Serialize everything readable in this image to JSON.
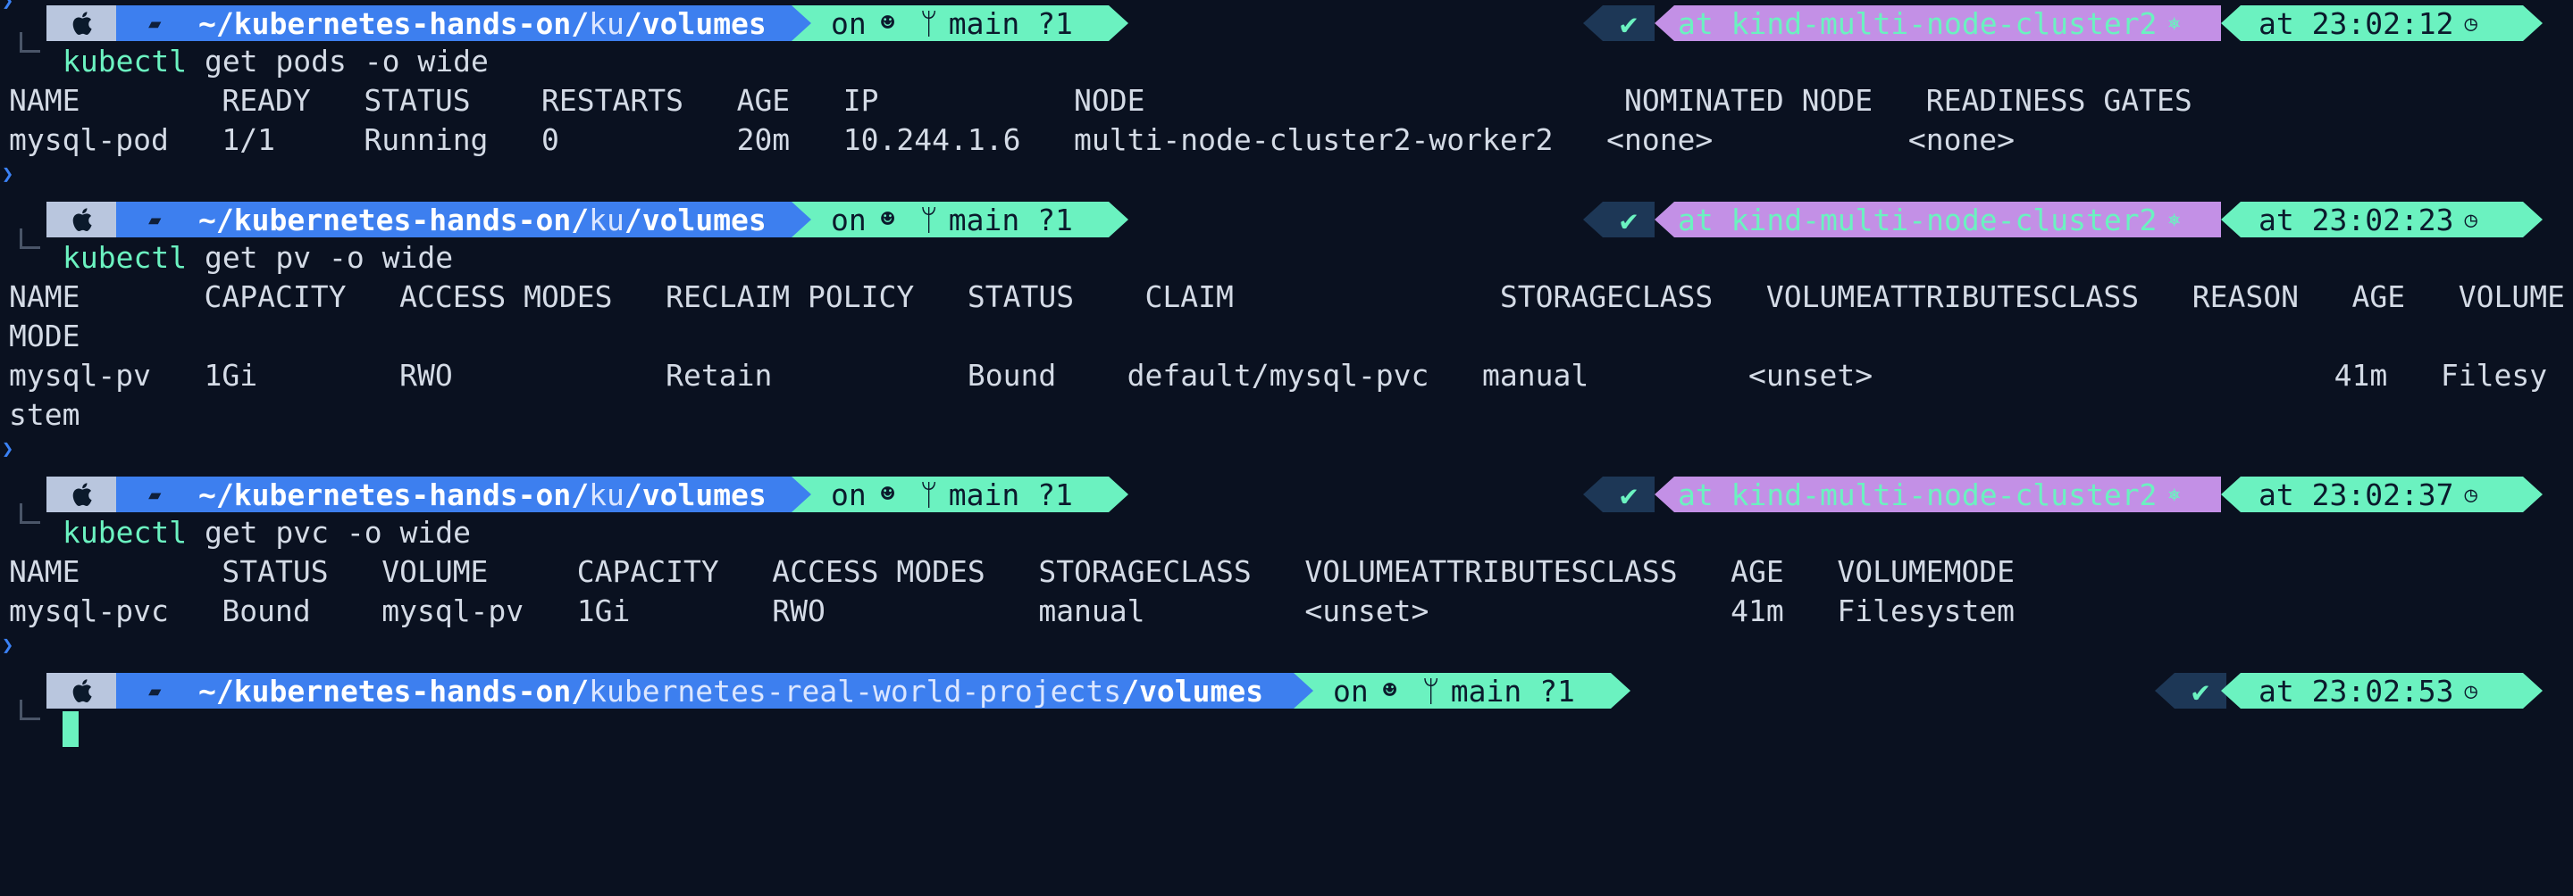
{
  "prompts": [
    {
      "path_home": "~/kubernetes-hands-on/",
      "path_mid": "ku",
      "path_sep": "/",
      "path_leaf": "volumes",
      "git_on": "on",
      "git_branch": "main ?1",
      "check": "✔",
      "context": "at kind-multi-node-cluster2",
      "time": "at 23:02:12",
      "command_keyword": "kubectl",
      "command_args": " get pods -o wide"
    },
    {
      "path_home": "~/kubernetes-hands-on/",
      "path_mid": "ku",
      "path_sep": "/",
      "path_leaf": "volumes",
      "git_on": "on",
      "git_branch": "main ?1",
      "check": "✔",
      "context": "at kind-multi-node-cluster2",
      "time": "at 23:02:23",
      "command_keyword": "kubectl",
      "command_args": " get pv -o wide"
    },
    {
      "path_home": "~/kubernetes-hands-on/",
      "path_mid": "ku",
      "path_sep": "/",
      "path_leaf": "volumes",
      "git_on": "on",
      "git_branch": "main ?1",
      "check": "✔",
      "context": "at kind-multi-node-cluster2",
      "time": "at 23:02:37",
      "command_keyword": "kubectl",
      "command_args": " get pvc -o wide"
    },
    {
      "path_home": "~/kubernetes-hands-on/",
      "path_mid": "kubernetes-real-world-projects",
      "path_sep": "/",
      "path_leaf": "volumes",
      "git_on": "on",
      "git_branch": "main ?1",
      "check": "✔",
      "time": "at 23:02:53"
    }
  ],
  "output": {
    "pods_header": "NAME        READY   STATUS    RESTARTS   AGE   IP           NODE                           NOMINATED NODE   READINESS GATES",
    "pods_row": "mysql-pod   1/1     Running   0          20m   10.244.1.6   multi-node-cluster2-worker2   <none>           <none>",
    "pv_header": "NAME       CAPACITY   ACCESS MODES   RECLAIM POLICY   STATUS    CLAIM               STORAGECLASS   VOLUMEATTRIBUTESCLASS   REASON   AGE   VOLUME",
    "pv_header_wrap": "MODE",
    "pv_row": "mysql-pv   1Gi        RWO            Retain           Bound    default/mysql-pvc   manual         <unset>                          41m   Filesy",
    "pv_row_wrap": "stem",
    "pvc_header": "NAME        STATUS   VOLUME     CAPACITY   ACCESS MODES   STORAGECLASS   VOLUMEATTRIBUTESCLASS   AGE   VOLUMEMODE",
    "pvc_row": "mysql-pvc   Bound    mysql-pv   1Gi        RWO            manual         <unset>                 41m   Filesystem"
  },
  "icons": {
    "caret": "caret-right-icon",
    "apple": "apple-icon",
    "folder": "folder-icon",
    "github": "github-icon",
    "branch": "git-branch-icon",
    "context": "kubernetes-icon",
    "clock": "clock-icon"
  },
  "colors": {
    "background": "#0a1120",
    "path_blue": "#3d7fef",
    "git_green": "#6bf2c0",
    "context_purple": "#c390e6",
    "check_bg": "#1d3756"
  }
}
